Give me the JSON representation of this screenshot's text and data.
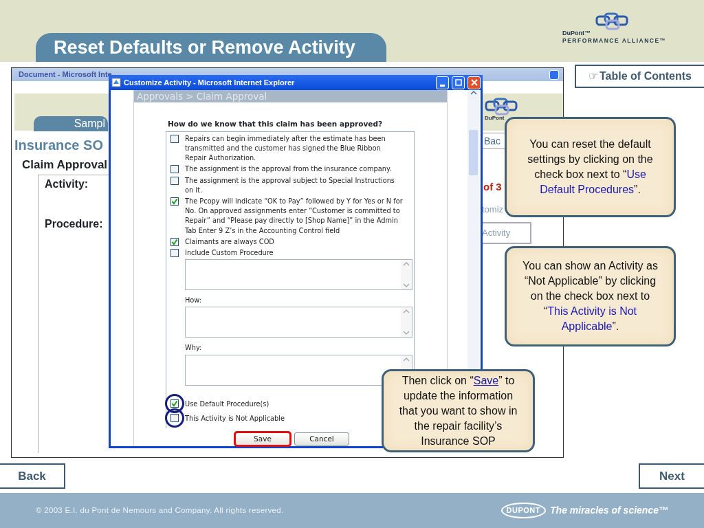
{
  "header": {
    "title": "Reset Defaults or Remove Activity",
    "logo_brand": "DuPont™",
    "logo_tagline": "PERFORMANCE ALLIANCE™"
  },
  "toc_button": {
    "icon": "☞",
    "label": "Table of Contents"
  },
  "background_window": {
    "title": "Document - Microsoft Inte",
    "tab": "Sampl",
    "heading": "Insurance SO",
    "section": "Claim Approval",
    "labels": [
      "Activity:",
      "Procedure:"
    ],
    "logo_text": "DuPont",
    "side_button": "Bac",
    "page_count": "of 3",
    "side_link": "tomiz",
    "side_tab": "Activity"
  },
  "dialog": {
    "title": "Customize Activity - Microsoft Internet Explorer",
    "breadcrumb": "Approvals > Claim Approval",
    "question": "How do we know that this claim has been approved?",
    "options": [
      {
        "label": "Repairs can begin immediately after the estimate has been transmitted and the customer has signed the Blue Ribbon Repair Authorization.",
        "checked": false
      },
      {
        "label": "The assignment is the approval from the insurance company.",
        "checked": false
      },
      {
        "label": "The assignment is the approval subject to Special Instructions on it.",
        "checked": false
      },
      {
        "label": "The Pcopy will indicate “OK to Pay” followed by Y for Yes or N for No. On approved assignments enter “Customer is committed to Repair” and “Please pay directly to [Shop Name]” in the Admin Tab Enter 9 Z’s in the Accounting Control field",
        "checked": true
      },
      {
        "label": "Claimants are always COD",
        "checked": true
      },
      {
        "label": "Include Custom Procedure",
        "checked": false,
        "kind": "with_text_area"
      }
    ],
    "text_areas": [
      {
        "label": "How:"
      },
      {
        "label": "Why:"
      }
    ],
    "bottom_options": [
      {
        "label": "Use Default Procedure(s)",
        "checked": true,
        "circled": true
      },
      {
        "label": "This Activity is Not Applicable",
        "checked": false,
        "circled": true
      }
    ],
    "buttons": [
      {
        "label": "Save",
        "highlighted": true
      },
      {
        "label": "Cancel",
        "highlighted": false
      }
    ]
  },
  "callouts": [
    {
      "parts": [
        {
          "text": "You can reset the default settings by clicking on the check box next to “",
          "kind": "plain"
        },
        {
          "text": "Use Default Procedures",
          "kind": "accent"
        },
        {
          "text": "”.",
          "kind": "plain"
        }
      ]
    },
    {
      "parts": [
        {
          "text": "You can show an Activity as “Not Applicable” by clicking on the check box next to “",
          "kind": "plain"
        },
        {
          "text": "This Activity is Not Applicable",
          "kind": "accent"
        },
        {
          "text": "”.",
          "kind": "plain"
        }
      ]
    },
    {
      "parts": [
        {
          "text": "Then click on “",
          "kind": "plain"
        },
        {
          "text": "Save",
          "kind": "link"
        },
        {
          "text": "” to update the information that you want to show in the repair facility’s Insurance SOP",
          "kind": "plain"
        }
      ]
    }
  ],
  "nav_buttons": [
    "Back",
    "Next"
  ],
  "footer": {
    "copyright": "© 2003 E.I. du Pont de Nemours and Company. All rights reserved.",
    "logo": "DUPONT",
    "tagline": "The miracles of science™"
  }
}
